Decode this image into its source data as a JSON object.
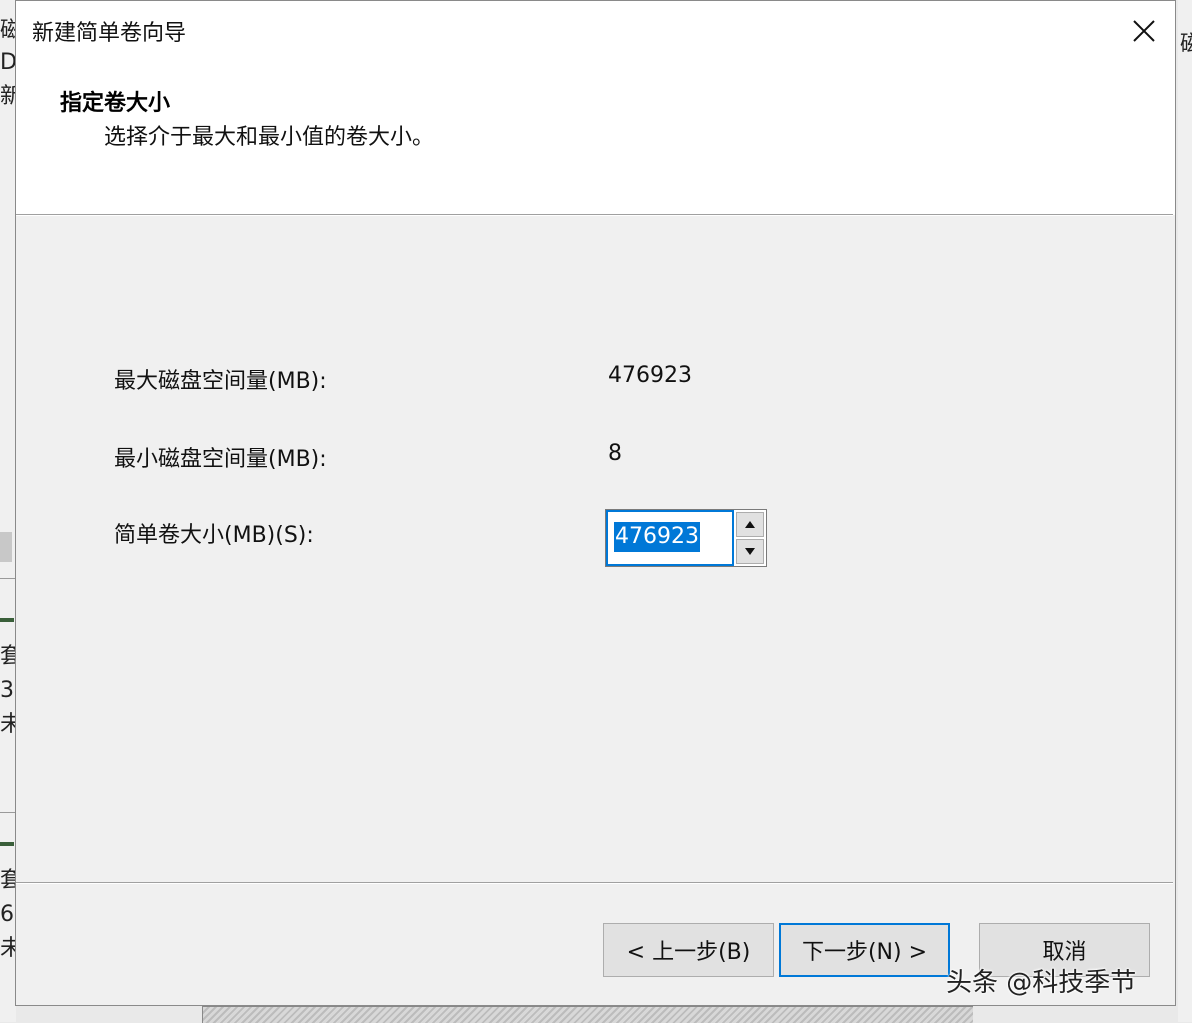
{
  "background": {
    "left_fragments": [
      "磁",
      "D",
      "新",
      "套",
      "3",
      "未",
      "套",
      "6",
      "未"
    ],
    "right_fragment": "磁"
  },
  "dialog": {
    "title": "新建简单卷向导",
    "header": {
      "title": "指定卷大小",
      "subtitle": "选择介于最大和最小值的卷大小。"
    },
    "fields": {
      "max_label": "最大磁盘空间量(MB):",
      "max_value": "476923",
      "min_label": "最小磁盘空间量(MB):",
      "min_value": "8",
      "size_label": "简单卷大小(MB)(S):",
      "size_value": "476923"
    },
    "buttons": {
      "back": "< 上一步(B)",
      "next": "下一步(N) >",
      "cancel": "取消"
    }
  },
  "watermark": "头条 @科技季节",
  "colors": {
    "accent": "#0078d7",
    "dialog_bg": "#f0f0f0",
    "header_bg": "#ffffff",
    "button_bg": "#e1e1e1"
  },
  "icons": {
    "close": "close-icon",
    "spin_up": "arrow-up-icon",
    "spin_down": "arrow-down-icon"
  }
}
